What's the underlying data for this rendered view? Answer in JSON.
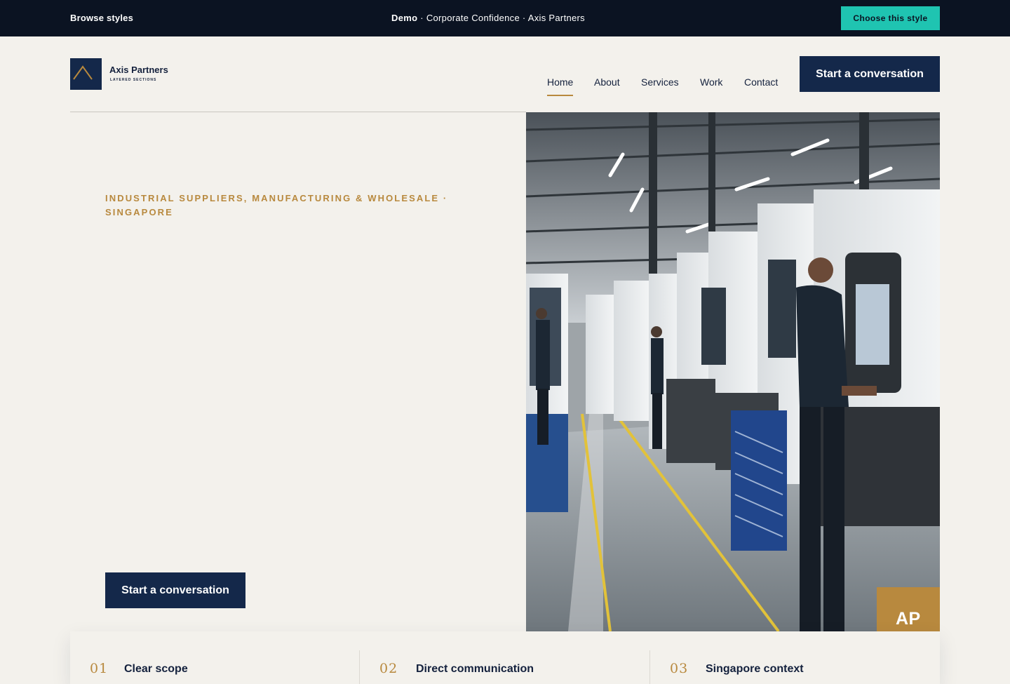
{
  "demo_bar": {
    "browse_label": "Browse styles",
    "demo_word": "Demo",
    "separator": " · ",
    "style_name": "Corporate Confidence",
    "company": "Axis Partners",
    "choose_label": "Choose this style"
  },
  "header": {
    "brand_name": "Axis Partners",
    "brand_tagline": "LAYERED SECTIONS",
    "nav": [
      {
        "label": "Home",
        "active": true
      },
      {
        "label": "About",
        "active": false
      },
      {
        "label": "Services",
        "active": false
      },
      {
        "label": "Work",
        "active": false
      },
      {
        "label": "Contact",
        "active": false
      }
    ],
    "cta_label": "Start a conversation"
  },
  "hero": {
    "eyebrow": "INDUSTRIAL SUPPLIERS, MANUFACTURING & WHOLESALE · SINGAPORE",
    "cta_label": "Start a conversation",
    "badge": "AP"
  },
  "features": [
    {
      "number": "01",
      "title": "Clear scope"
    },
    {
      "number": "02",
      "title": "Direct communication"
    },
    {
      "number": "03",
      "title": "Singapore context"
    }
  ],
  "colors": {
    "navy": "#14284a",
    "dark_bar": "#0b1322",
    "gold": "#b8893e",
    "teal": "#1fc4b1",
    "background": "#f3f1ec"
  }
}
